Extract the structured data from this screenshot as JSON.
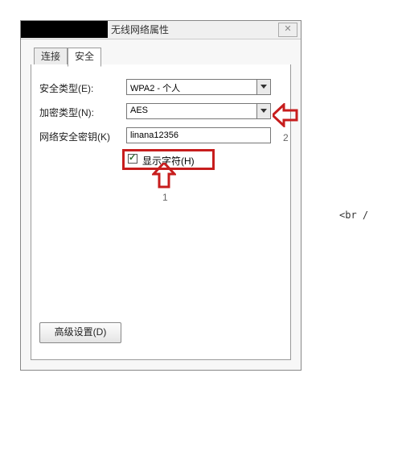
{
  "window": {
    "title": "无线网络属性",
    "close_glyph": "✕"
  },
  "tabs": {
    "connect": "连接",
    "security": "安全"
  },
  "form": {
    "security_type_label": "安全类型(E):",
    "security_type_value": "WPA2 - 个人",
    "encryption_type_label": "加密类型(N):",
    "encryption_type_value": "AES",
    "network_key_label": "网络安全密钥(K)",
    "network_key_value": "linana12356",
    "show_chars_label": "显示字符(H)"
  },
  "advanced_button": "高级设置(D)",
  "annotations": {
    "num1": "1",
    "num2": "2"
  },
  "stray": "<br /"
}
